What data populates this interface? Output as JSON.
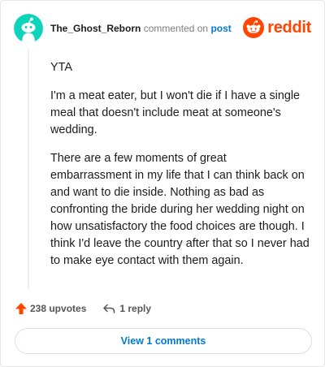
{
  "header": {
    "author": "The_Ghost_Reborn",
    "commented_on": "commented on",
    "post_link": "post",
    "brand": "reddit"
  },
  "comment": {
    "paragraphs": [
      "YTA",
      "I'm a meat eater, but I won't die if I have a single meal that doesn't include meat at someone's wedding.",
      "There are a few moments of great embarrassment in my life that I can think back on and want to die inside. Nothing as bad as confronting the bride during her wedding night on how unsatisfactory the food choices are though. I think I'd leave the country after that so I never had to make eye contact with them again."
    ]
  },
  "actions": {
    "upvotes": "238 upvotes",
    "replies": "1 reply"
  },
  "footer": {
    "view_comments": "View 1 comments"
  },
  "colors": {
    "brand": "#ff4500",
    "link": "#0079d3",
    "avatar_bg": "#0dd3bb",
    "upvote": "#ff4500"
  },
  "icons": {
    "avatar": "snoo-avatar-icon",
    "logo": "reddit-snoo-icon",
    "upvote": "upvote-arrow-icon",
    "reply": "reply-arrow-icon"
  }
}
